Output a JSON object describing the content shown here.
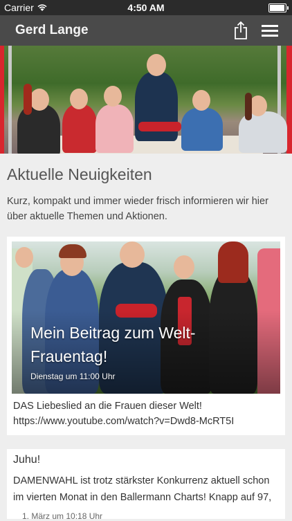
{
  "status_bar": {
    "carrier": "Carrier",
    "time": "4:50 AM",
    "battery_level": 0.95
  },
  "nav": {
    "title": "Gerd Lange",
    "share_icon": "share-icon",
    "menu_icon": "hamburger-menu-icon"
  },
  "section": {
    "title": "Aktuelle Neuigkeiten",
    "intro": "Kurz, kompakt und immer wieder frisch informieren wir hier über aktuelle Themen und Aktionen."
  },
  "posts": [
    {
      "headline": "Mein Beitrag zum Welt-Frauentag!",
      "date": "Dienstag um 11:00 Uhr",
      "text": "DAS Liebeslied an die Frauen dieser Welt! https://www.youtube.com/watch?v=Dwd8-McRT5I"
    },
    {
      "title": "Juhu!",
      "text": "DAMENWAHL ist trotz stärkster Konkurrenz aktuell schon im vierten Monat in den Ballermann Charts! Knapp auf 97,",
      "date": "1. März um 10:18 Uhr"
    }
  ]
}
